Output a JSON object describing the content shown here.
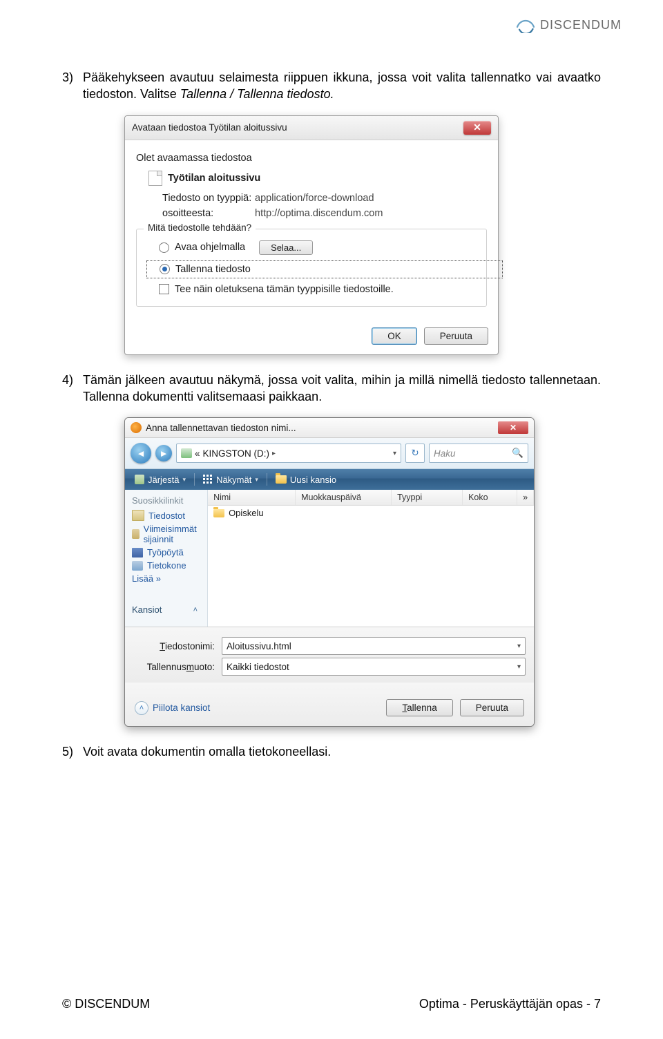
{
  "header": {
    "brand": "DISCENDUM"
  },
  "para3": {
    "num": "3)",
    "text_a": "Pääkehykseen avautuu selaimesta riippuen ikkuna, jossa voit valita tallennatko vai avaatko tiedoston. Valitse ",
    "italic": "Tallenna / Tallenna tiedosto.",
    "text_b": ""
  },
  "dialog1": {
    "title": "Avataan tiedostoa Työtilan aloitussivu",
    "close_aria": "Sulje",
    "intro": "Olet avaamassa tiedostoa",
    "filename": "Työtilan aloitussivu",
    "type_label": "Tiedosto on tyyppiä:",
    "type_value": "application/force-download",
    "from_label": "osoitteesta:",
    "from_value": "http://optima.discendum.com",
    "group_title": "Mitä tiedostolle tehdään?",
    "option_open": "Avaa ohjelmalla",
    "browse_label": "Selaa...",
    "option_save": "Tallenna tiedosto",
    "remember": "Tee näin oletuksena tämän tyyppisille tiedostoille.",
    "ok": "OK",
    "cancel": "Peruuta"
  },
  "para4": {
    "num": "4)",
    "text": "Tämän jälkeen avautuu näkymä, jossa voit valita, mihin ja millä nimellä tiedosto tallennetaan. Tallenna dokumentti valitsemaasi paikkaan."
  },
  "dialog2": {
    "title": "Anna tallennettavan tiedoston nimi...",
    "close_aria": "Sulje",
    "breadcrumb_seg1": "«",
    "breadcrumb_seg2": "KINGSTON (D:)",
    "search_placeholder": "Haku",
    "toolbar": {
      "organize": "Järjestä",
      "views": "Näkymät",
      "newfolder": "Uusi kansio"
    },
    "sidebar": {
      "favs_header": "Suosikkilinkit",
      "items": [
        {
          "label": "Tiedostot"
        },
        {
          "label": "Viimeisimmät sijainnit"
        },
        {
          "label": "Työpöytä"
        },
        {
          "label": "Tietokone"
        }
      ],
      "more": "Lisää  »",
      "folders_header": "Kansiot"
    },
    "columns": {
      "name": "Nimi",
      "modified": "Muokkauspäivä",
      "type": "Tyyppi",
      "size": "Koko",
      "more": "»"
    },
    "file_row": "Opiskelu",
    "filename_label": "Tiedostonimi:",
    "filename_value": "Aloitussivu.html",
    "filetype_label": "Tallennusmuoto:",
    "filetype_value": "Kaikki tiedostot",
    "hide_folders": "Piilota kansiot",
    "save": "Tallenna",
    "cancel": "Peruuta"
  },
  "para5": {
    "num": "5)",
    "text": "Voit avata dokumentin omalla tietokoneellasi."
  },
  "footer": {
    "left": "© DISCENDUM",
    "right": "Optima - Peruskäyttäjän opas - 7"
  }
}
